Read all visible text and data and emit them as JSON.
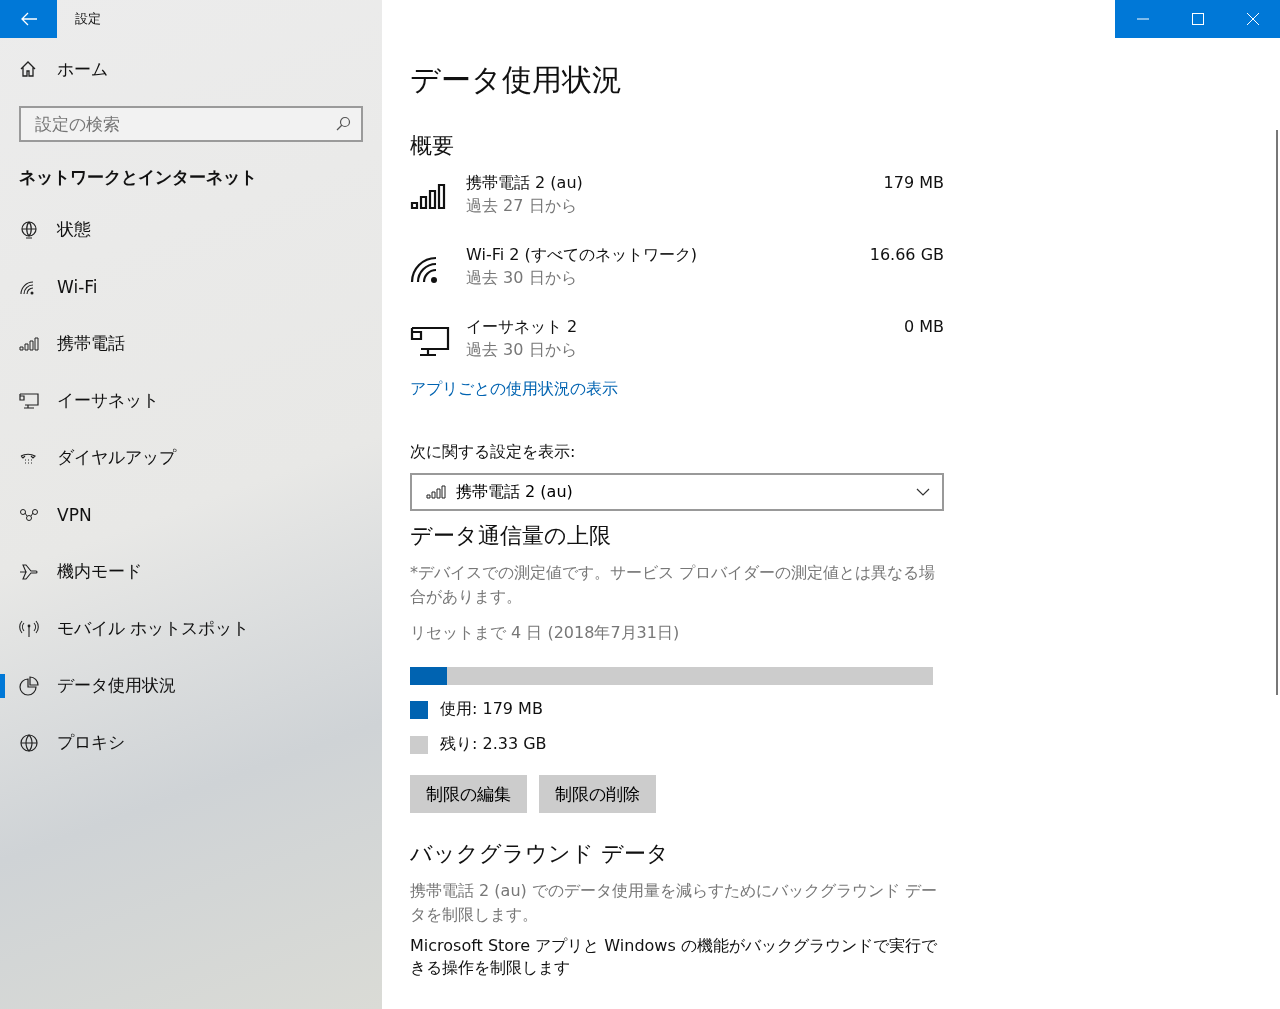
{
  "window": {
    "title": "設定",
    "controls": [
      {
        "kind": "minimize"
      },
      {
        "kind": "maximize"
      },
      {
        "kind": "close"
      }
    ]
  },
  "sidebar": {
    "home": "ホーム",
    "search": {
      "placeholder": "設定の検索"
    },
    "section_title": "ネットワークとインターネット",
    "items": [
      {
        "label": "状態",
        "kind": "status",
        "selected": false
      },
      {
        "label": "Wi-Fi",
        "kind": "wifi",
        "selected": false
      },
      {
        "label": "携帯電話",
        "kind": "cellular",
        "selected": false
      },
      {
        "label": "イーサネット",
        "kind": "ethernet",
        "selected": false
      },
      {
        "label": "ダイヤルアップ",
        "kind": "dialup",
        "selected": false
      },
      {
        "label": "VPN",
        "kind": "vpn",
        "selected": false
      },
      {
        "label": "機内モード",
        "kind": "airplane",
        "selected": false
      },
      {
        "label": "モバイル ホットスポット",
        "kind": "hotspot",
        "selected": false
      },
      {
        "label": "データ使用状況",
        "kind": "datausage",
        "selected": true
      },
      {
        "label": "プロキシ",
        "kind": "proxy",
        "selected": false
      }
    ]
  },
  "main": {
    "title": "データ使用状況",
    "overview_title": "概要",
    "usage": [
      {
        "kind": "cellular",
        "name": "携帯電話 2 (au)",
        "period": "過去 27 日から",
        "amount": "179 MB"
      },
      {
        "kind": "wifi",
        "name": "Wi-Fi 2 (すべてのネットワーク)",
        "period": "過去 30 日から",
        "amount": "16.66 GB"
      },
      {
        "kind": "ethernet",
        "name": "イーサネット 2",
        "period": "過去 30 日から",
        "amount": "0 MB"
      }
    ],
    "per_app_link": "アプリごとの使用状況の表示",
    "settings_for_label": "次に関する設定を表示:",
    "settings_for_dropdown": {
      "kind": "cellular",
      "value": "携帯電話 2 (au)"
    },
    "limit": {
      "title": "データ通信量の上限",
      "note": "*デバイスでの測定値です。サービス プロバイダーの測定値とは異なる場合があります。",
      "reset": "リセットまで 4 日 (2018年7月31日)",
      "level": 0.07,
      "legend": [
        {
          "label": "使用: 179 MB",
          "color": "#0063b1"
        },
        {
          "label": "残り: 2.33 GB",
          "color": "#cccccc"
        }
      ],
      "buttons": [
        "制限の編集",
        "制限の削除"
      ]
    },
    "background": {
      "title": "バックグラウンド データ",
      "description": "携帯電話 2 (au) でのデータ使用量を減らすためにバックグラウンド データを制限します。",
      "text": "Microsoft Store アプリと Windows の機能がバックグラウンドで実行できる操作を制限します"
    }
  }
}
